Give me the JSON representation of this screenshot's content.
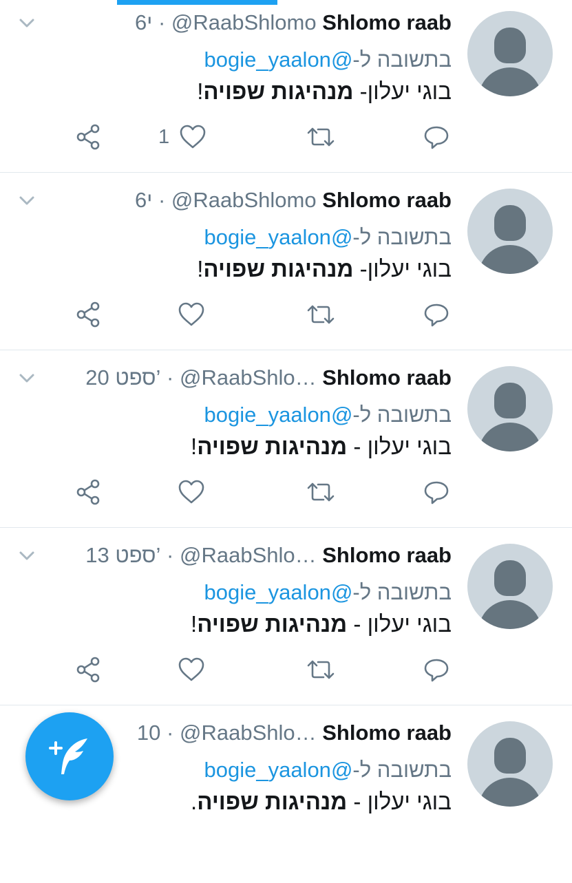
{
  "colors": {
    "accent": "#1da1f2",
    "mention": "#1b95e0",
    "secondary_text": "#657786",
    "divider": "#e1e8ed"
  },
  "tweets": [
    {
      "name": "Shlomo raab",
      "handle": "@RaabShlomo",
      "separator": "·",
      "time": "6י",
      "reply_prefix": "בתשובה ל-",
      "reply_mention": "@bogie_yaalon",
      "body_normal": "בוגי יעלון- ",
      "body_bold": "מנהיגות שפויה",
      "body_end": "!",
      "like_count": "1"
    },
    {
      "name": "Shlomo raab",
      "handle": "@RaabShlomo",
      "separator": "·",
      "time": "6י",
      "reply_prefix": "בתשובה ל-",
      "reply_mention": "@bogie_yaalon",
      "body_normal": "בוגי יעלון- ",
      "body_bold": "מנהיגות שפויה",
      "body_end": "!",
      "like_count": ""
    },
    {
      "name": "Shlomo raab",
      "handle": "@RaabShlo…",
      "separator": "·",
      "time": "20 ספט’",
      "reply_prefix": "בתשובה ל-",
      "reply_mention": "@bogie_yaalon",
      "body_normal": "בוגי יעלון - ",
      "body_bold": "מנהיגות שפויה",
      "body_end": "!",
      "like_count": ""
    },
    {
      "name": "Shlomo raab",
      "handle": "@RaabShlo…",
      "separator": "·",
      "time": "13 ספט’",
      "reply_prefix": "בתשובה ל-",
      "reply_mention": "@bogie_yaalon",
      "body_normal": "בוגי יעלון - ",
      "body_bold": "מנהיגות שפויה",
      "body_end": "!",
      "like_count": ""
    },
    {
      "name": "Shlomo raab",
      "handle": "@RaabShlo…",
      "separator": "·",
      "time": "10",
      "reply_prefix": "בתשובה ל-",
      "reply_mention": "@bogie_yaalon",
      "body_normal": "בוגי יעלון - ",
      "body_bold": "מנהיגות שפויה",
      "body_end": ".",
      "like_count": ""
    }
  ],
  "icons": {
    "reply": "reply-icon",
    "retweet": "retweet-icon",
    "like": "heart-icon",
    "share": "share-icon",
    "caret": "chevron-down-icon",
    "compose": "compose-tweet-icon"
  }
}
